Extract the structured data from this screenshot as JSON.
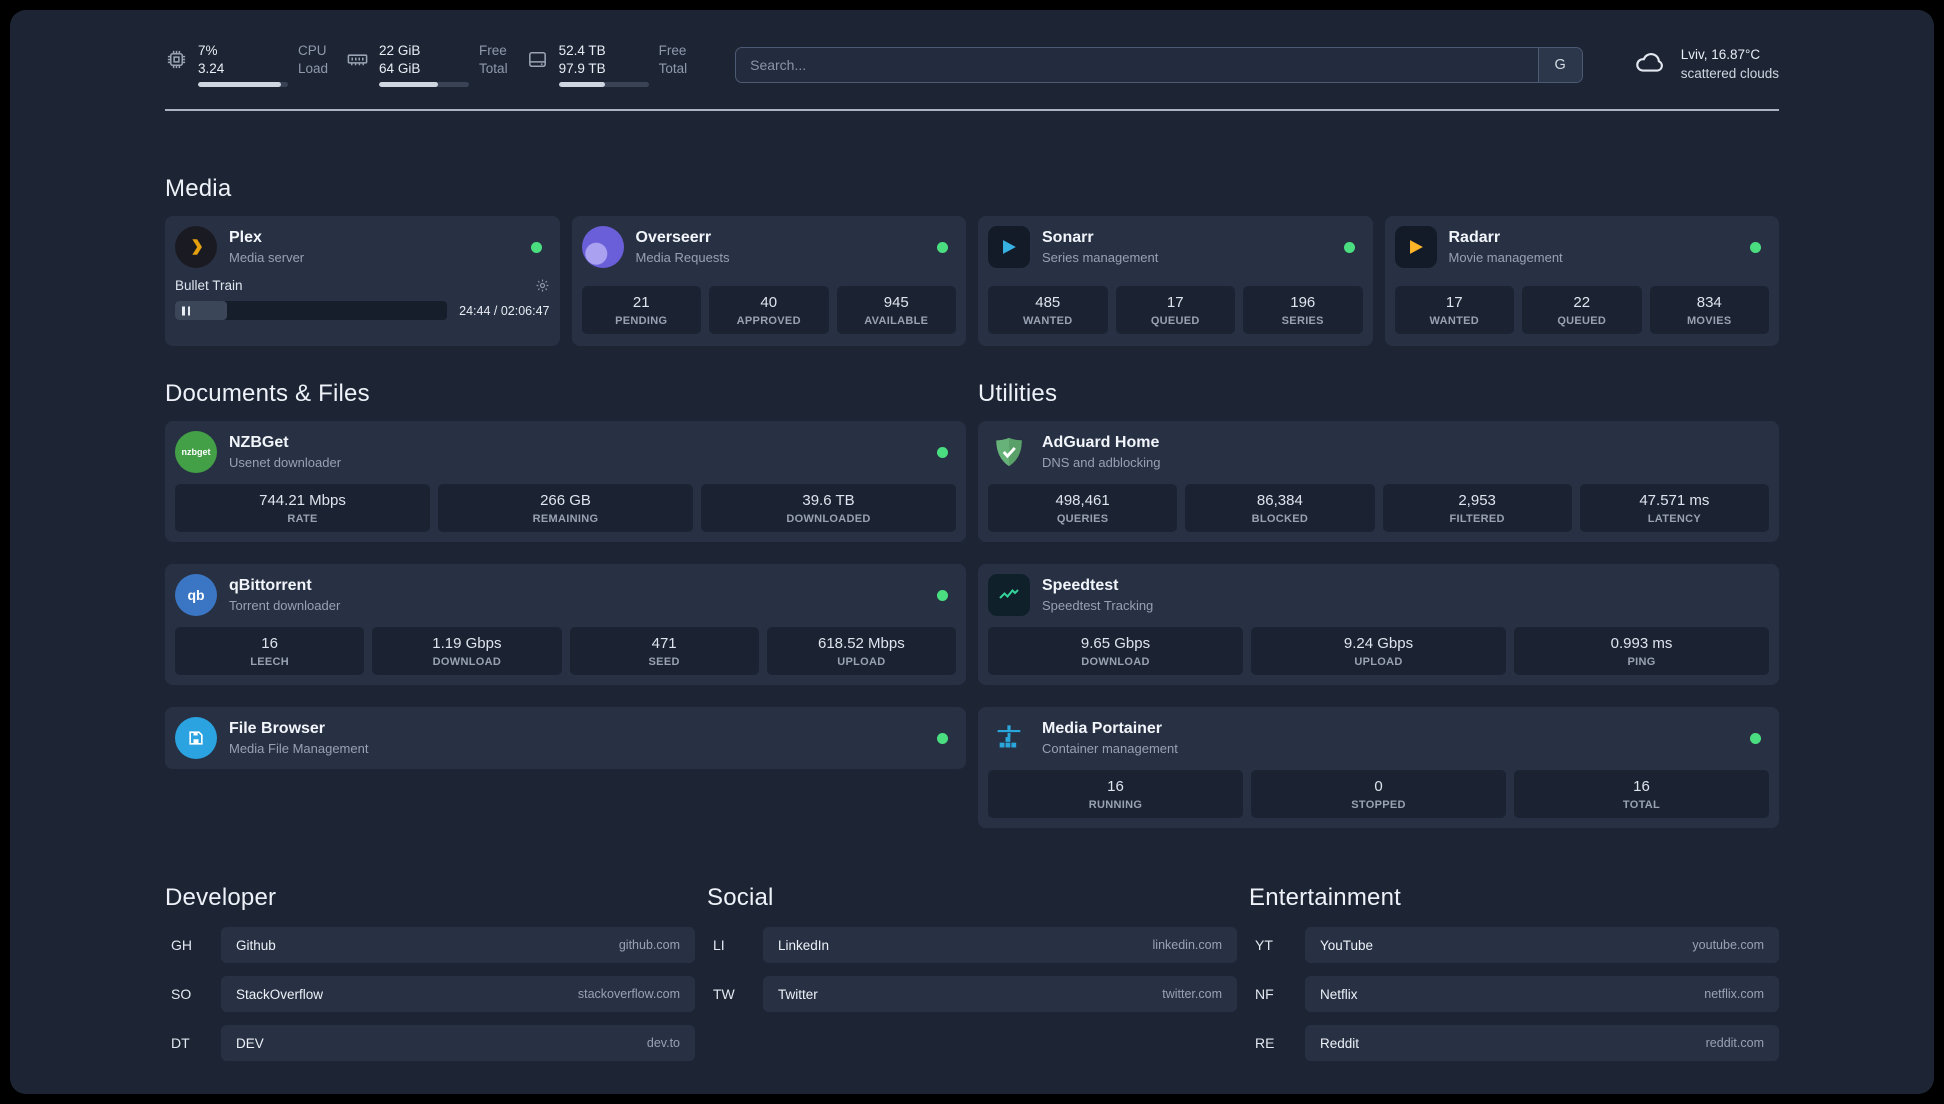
{
  "topbar": {
    "cpu": {
      "value_top": "7%",
      "value_bottom": "3.24",
      "label_top": "CPU",
      "label_bottom": "Load",
      "bar_percent": 92
    },
    "ram": {
      "value_top": "22 GiB",
      "value_bottom": "64 GiB",
      "label_top": "Free",
      "label_bottom": "Total",
      "bar_percent": 65
    },
    "disk": {
      "value_top": "52.4 TB",
      "value_bottom": "97.9 TB",
      "label_top": "Free",
      "label_bottom": "Total",
      "bar_percent": 52
    },
    "search": {
      "placeholder": "Search...",
      "button_label": "G"
    },
    "weather": {
      "location": "Lviv, 16.87°C",
      "condition": "scattered clouds"
    }
  },
  "sections": {
    "media": {
      "heading": "Media",
      "plex": {
        "name": "Plex",
        "description": "Media server",
        "now_playing": "Bullet Train",
        "time": "24:44 / 02:06:47",
        "progress_percent": 19
      },
      "overseerr": {
        "name": "Overseerr",
        "description": "Media Requests",
        "stats": [
          {
            "value": "21",
            "label": "PENDING"
          },
          {
            "value": "40",
            "label": "APPROVED"
          },
          {
            "value": "945",
            "label": "AVAILABLE"
          }
        ]
      },
      "sonarr": {
        "name": "Sonarr",
        "description": "Series management",
        "stats": [
          {
            "value": "485",
            "label": "WANTED"
          },
          {
            "value": "17",
            "label": "QUEUED"
          },
          {
            "value": "196",
            "label": "SERIES"
          }
        ]
      },
      "radarr": {
        "name": "Radarr",
        "description": "Movie management",
        "stats": [
          {
            "value": "17",
            "label": "WANTED"
          },
          {
            "value": "22",
            "label": "QUEUED"
          },
          {
            "value": "834",
            "label": "MOVIES"
          }
        ]
      }
    },
    "documents": {
      "heading": "Documents & Files",
      "nzbget": {
        "name": "NZBGet",
        "description": "Usenet downloader",
        "icon_badge": "nzbget",
        "stats": [
          {
            "value": "744.21 Mbps",
            "label": "RATE"
          },
          {
            "value": "266 GB",
            "label": "REMAINING"
          },
          {
            "value": "39.6 TB",
            "label": "DOWNLOADED"
          }
        ]
      },
      "qbittorrent": {
        "name": "qBittorrent",
        "description": "Torrent downloader",
        "icon_badge": "qb",
        "stats": [
          {
            "value": "16",
            "label": "LEECH"
          },
          {
            "value": "1.19 Gbps",
            "label": "DOWNLOAD"
          },
          {
            "value": "471",
            "label": "SEED"
          },
          {
            "value": "618.52 Mbps",
            "label": "UPLOAD"
          }
        ]
      },
      "filebrowser": {
        "name": "File Browser",
        "description": "Media File Management"
      }
    },
    "utilities": {
      "heading": "Utilities",
      "adguard": {
        "name": "AdGuard Home",
        "description": "DNS and adblocking",
        "stats": [
          {
            "value": "498,461",
            "label": "QUERIES"
          },
          {
            "value": "86,384",
            "label": "BLOCKED"
          },
          {
            "value": "2,953",
            "label": "FILTERED"
          },
          {
            "value": "47.571 ms",
            "label": "LATENCY"
          }
        ]
      },
      "speedtest": {
        "name": "Speedtest",
        "description": "Speedtest Tracking",
        "stats": [
          {
            "value": "9.65 Gbps",
            "label": "DOWNLOAD"
          },
          {
            "value": "9.24 Gbps",
            "label": "UPLOAD"
          },
          {
            "value": "0.993 ms",
            "label": "PING"
          }
        ]
      },
      "portainer": {
        "name": "Media Portainer",
        "description": "Container management",
        "stats": [
          {
            "value": "16",
            "label": "RUNNING"
          },
          {
            "value": "0",
            "label": "STOPPED"
          },
          {
            "value": "16",
            "label": "TOTAL"
          }
        ]
      }
    }
  },
  "bookmarks": [
    {
      "heading": "Developer",
      "items": [
        {
          "abbr": "GH",
          "name": "Github",
          "url": "github.com"
        },
        {
          "abbr": "SO",
          "name": "StackOverflow",
          "url": "stackoverflow.com"
        },
        {
          "abbr": "DT",
          "name": "DEV",
          "url": "dev.to"
        }
      ]
    },
    {
      "heading": "Social",
      "items": [
        {
          "abbr": "LI",
          "name": "LinkedIn",
          "url": "linkedin.com"
        },
        {
          "abbr": "TW",
          "name": "Twitter",
          "url": "twitter.com"
        }
      ]
    },
    {
      "heading": "Entertainment",
      "items": [
        {
          "abbr": "YT",
          "name": "YouTube",
          "url": "youtube.com"
        },
        {
          "abbr": "NF",
          "name": "Netflix",
          "url": "netflix.com"
        },
        {
          "abbr": "RE",
          "name": "Reddit",
          "url": "reddit.com"
        }
      ]
    }
  ],
  "colors": {
    "status_online": "#4ade80",
    "page_bg": "#1d2535",
    "card_bg": "#283144"
  }
}
